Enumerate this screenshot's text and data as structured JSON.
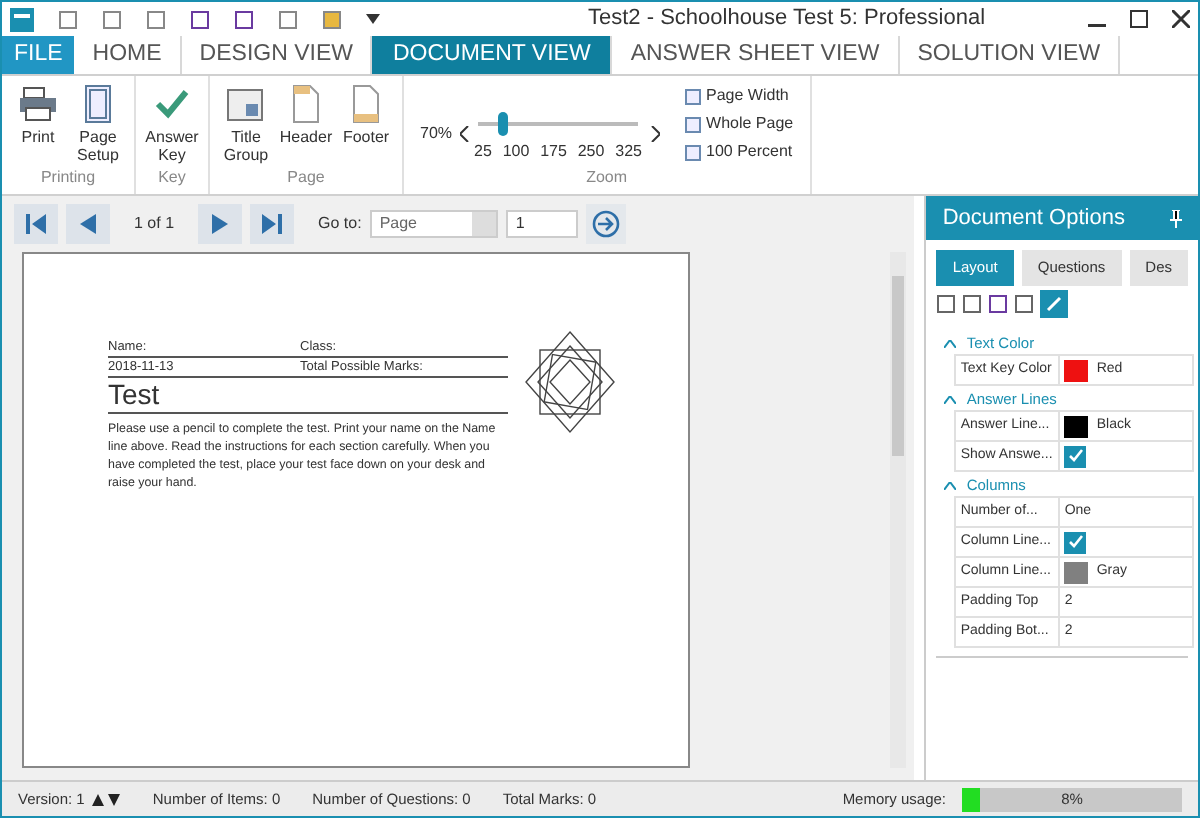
{
  "window": {
    "title": "Test2 - Schoolhouse Test 5: Professional"
  },
  "file_menu": {
    "label": "FILE"
  },
  "tabs": [
    {
      "label": "HOME",
      "selected": false
    },
    {
      "label": "DESIGN VIEW",
      "selected": false
    },
    {
      "label": "DOCUMENT VIEW",
      "selected": true
    },
    {
      "label": "ANSWER SHEET VIEW",
      "selected": false
    },
    {
      "label": "SOLUTION VIEW",
      "selected": false
    }
  ],
  "ribbon": {
    "groups": [
      {
        "label": "Printing",
        "buttons": [
          {
            "label": "Print"
          },
          {
            "label": "Page Setup"
          }
        ]
      },
      {
        "label": "Key",
        "buttons": [
          {
            "label": "Answer Key"
          }
        ]
      },
      {
        "label": "Page",
        "buttons": [
          {
            "label": "Title Group"
          },
          {
            "label": "Header"
          },
          {
            "label": "Footer"
          }
        ]
      }
    ],
    "zoom": {
      "label": "Zoom",
      "reading": "70%",
      "level": 0.15,
      "ticks": [
        "25",
        "100",
        "175",
        "250",
        "325"
      ],
      "options": [
        "Page Width",
        "Whole Page",
        "100 Percent"
      ]
    }
  },
  "navigator": {
    "page_count": "1 of 1",
    "goto_label": "Go to:",
    "goto_type": "Page",
    "goto_value": "1"
  },
  "document": {
    "name_label": "Name:",
    "class_label": "Class:",
    "date": "2018-11-13",
    "marks_label": "Total Possible Marks:",
    "title": "Test",
    "instructions": "Please use a pencil to complete the test. Print your name on the Name line above. Read the instructions for each section carefully. When you have completed the test, place your test face down on your desk and raise your hand."
  },
  "options_panel": {
    "title": "Document Options",
    "tabs": [
      {
        "label": "Layout",
        "selected": true
      },
      {
        "label": "Questions",
        "selected": false
      },
      {
        "label": "Des",
        "selected": false
      }
    ],
    "sections": [
      {
        "title": "Text Color",
        "expanded": true,
        "rows": [
          {
            "kind": "color",
            "name": "Text Key Color",
            "value": "Red",
            "color": "#ee1111"
          }
        ]
      },
      {
        "title": "Answer Lines",
        "expanded": true,
        "rows": [
          {
            "kind": "color",
            "name": "Answer Line...",
            "value": "Black",
            "color": "#000000"
          },
          {
            "kind": "check",
            "name": "Show Answe...",
            "checked": true
          }
        ]
      },
      {
        "title": "Columns",
        "expanded": true,
        "rows": [
          {
            "kind": "text",
            "name": "Number of...",
            "value": "One"
          },
          {
            "kind": "check",
            "name": "Column Line...",
            "checked": true
          },
          {
            "kind": "color",
            "name": "Column Line...",
            "value": "Gray",
            "color": "#808080"
          },
          {
            "kind": "text",
            "name": "Padding Top",
            "value": "2"
          },
          {
            "kind": "text",
            "name": "Padding Bot...",
            "value": "2"
          }
        ]
      }
    ]
  },
  "status_bar": {
    "version": "Version: 1",
    "items": "Number of Items: 0",
    "questions": "Number of Questions: 0",
    "marks": "Total Marks: 0",
    "memory": {
      "label": "Memory usage:",
      "level": 0.08,
      "reading": "8%"
    }
  }
}
